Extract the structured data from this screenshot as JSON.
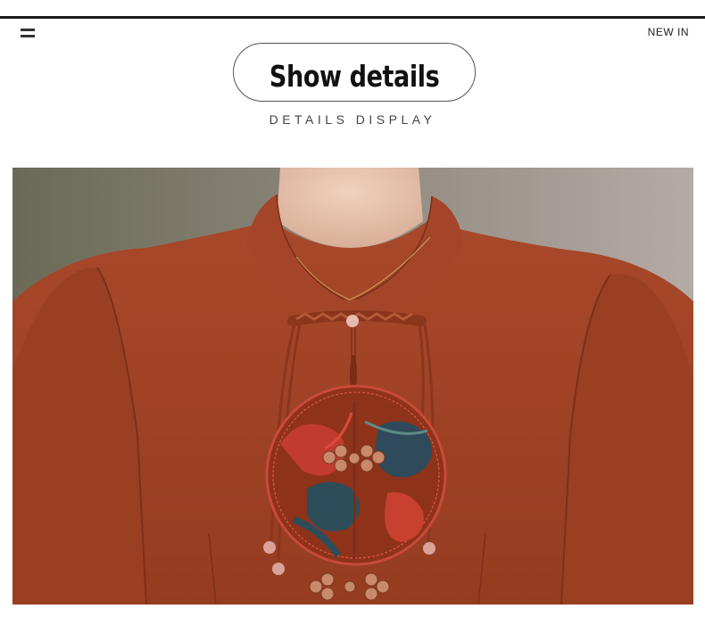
{
  "header": {
    "menu_icon": "hamburger-menu-icon",
    "new_in_label": "NEW IN"
  },
  "section": {
    "title": "Show details",
    "subtitle": "DETAILS DISPLAY"
  },
  "product_image": {
    "subject": "rust-red qipao-style blouse, embroidered round medallion, braided frog-knot collar closure",
    "colors": {
      "fabric": "#a24325",
      "fabric_shadow": "#7e2f18",
      "background": "#6d6b57",
      "skin": "#e6c3ad"
    }
  }
}
